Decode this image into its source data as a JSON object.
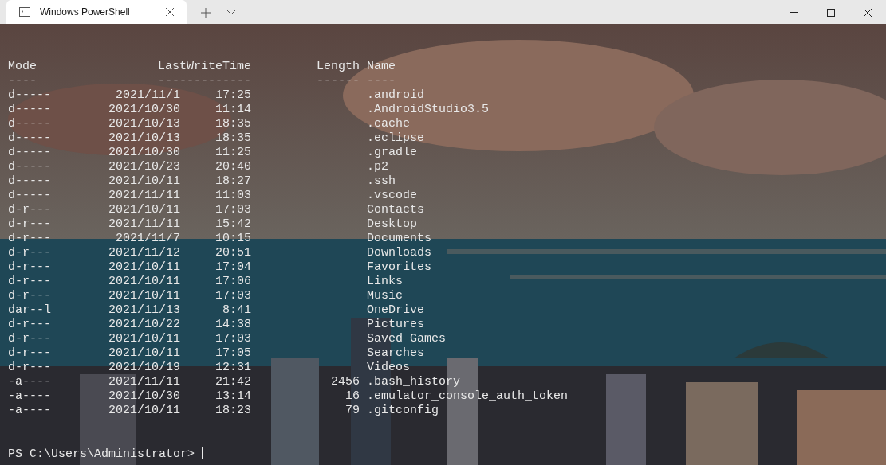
{
  "window": {
    "tabs": [
      {
        "title": "Windows PowerShell",
        "selected": true
      }
    ]
  },
  "listing": {
    "headers": {
      "mode": "Mode",
      "last_write_time": "LastWriteTime",
      "length": "Length",
      "name": "Name"
    },
    "underlines": {
      "mode": "----",
      "last_write_time": "-------------",
      "length": "------",
      "name": "----"
    },
    "rows": [
      {
        "mode": "d-----",
        "date": "2021/11/1",
        "time": "17:25",
        "length": "",
        "name": ".android"
      },
      {
        "mode": "d-----",
        "date": "2021/10/30",
        "time": "11:14",
        "name": ".AndroidStudio3.5"
      },
      {
        "mode": "d-----",
        "date": "2021/10/13",
        "time": "18:35",
        "name": ".cache"
      },
      {
        "mode": "d-----",
        "date": "2021/10/13",
        "time": "18:35",
        "name": ".eclipse"
      },
      {
        "mode": "d-----",
        "date": "2021/10/30",
        "time": "11:25",
        "name": ".gradle"
      },
      {
        "mode": "d-----",
        "date": "2021/10/23",
        "time": "20:40",
        "name": ".p2"
      },
      {
        "mode": "d-----",
        "date": "2021/10/11",
        "time": "18:27",
        "name": ".ssh"
      },
      {
        "mode": "d-----",
        "date": "2021/11/11",
        "time": "11:03",
        "name": ".vscode"
      },
      {
        "mode": "d-r---",
        "date": "2021/10/11",
        "time": "17:03",
        "name": "Contacts"
      },
      {
        "mode": "d-r---",
        "date": "2021/11/11",
        "time": "15:42",
        "name": "Desktop"
      },
      {
        "mode": "d-r---",
        "date": "2021/11/7",
        "time": "10:15",
        "name": "Documents"
      },
      {
        "mode": "d-r---",
        "date": "2021/11/12",
        "time": "20:51",
        "name": "Downloads"
      },
      {
        "mode": "d-r---",
        "date": "2021/10/11",
        "time": "17:04",
        "name": "Favorites"
      },
      {
        "mode": "d-r---",
        "date": "2021/10/11",
        "time": "17:06",
        "name": "Links"
      },
      {
        "mode": "d-r---",
        "date": "2021/10/11",
        "time": "17:03",
        "name": "Music"
      },
      {
        "mode": "dar--l",
        "date": "2021/11/13",
        "time": "8:41",
        "name": "OneDrive"
      },
      {
        "mode": "d-r---",
        "date": "2021/10/22",
        "time": "14:38",
        "name": "Pictures"
      },
      {
        "mode": "d-r---",
        "date": "2021/10/11",
        "time": "17:03",
        "name": "Saved Games"
      },
      {
        "mode": "d-r---",
        "date": "2021/10/11",
        "time": "17:05",
        "name": "Searches"
      },
      {
        "mode": "d-r---",
        "date": "2021/10/19",
        "time": "12:31",
        "name": "Videos"
      },
      {
        "mode": "-a----",
        "date": "2021/11/11",
        "time": "21:42",
        "length": "2456",
        "name": ".bash_history"
      },
      {
        "mode": "-a----",
        "date": "2021/10/30",
        "time": "13:14",
        "length": "16",
        "name": ".emulator_console_auth_token"
      },
      {
        "mode": "-a----",
        "date": "2021/10/11",
        "time": "18:23",
        "length": "79",
        "name": ".gitconfig"
      }
    ]
  },
  "prompt": "PS C:\\Users\\Administrator>"
}
